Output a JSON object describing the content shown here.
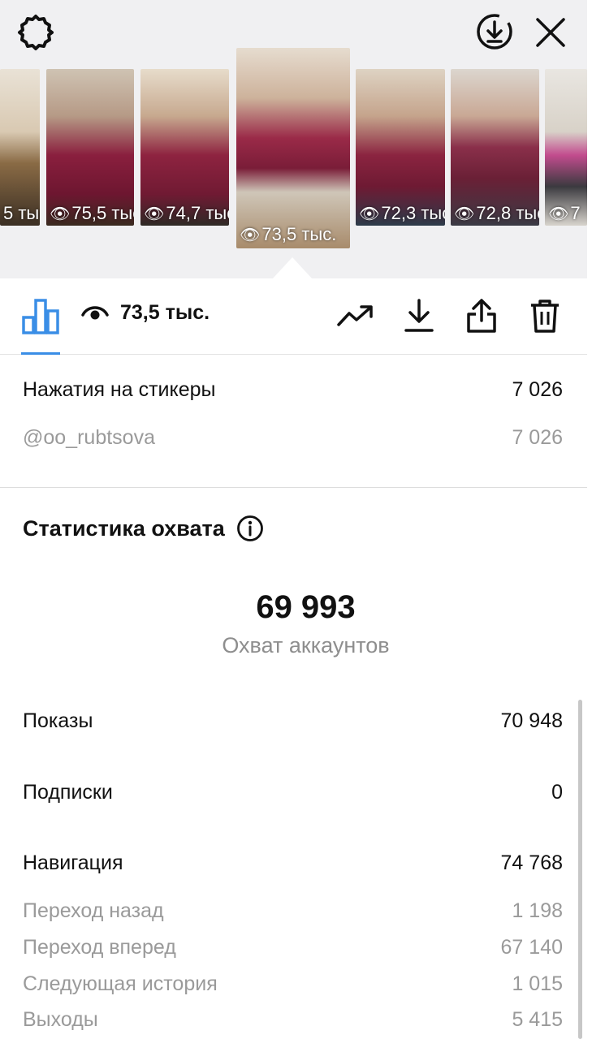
{
  "header": {
    "settings_icon": "gear-icon",
    "download_icon": "download-circle-icon",
    "close_icon": "close-icon"
  },
  "stories": [
    {
      "label": "5 тыс",
      "selected": false
    },
    {
      "label": "75,5 тыс",
      "selected": false
    },
    {
      "label": "74,7 тыс",
      "selected": false
    },
    {
      "label": "73,5 тыс.",
      "selected": true
    },
    {
      "label": "72,3 тыс",
      "selected": false
    },
    {
      "label": "72,8 тыс",
      "selected": false
    },
    {
      "label": "7",
      "selected": false
    }
  ],
  "toolbar": {
    "views_value": "73,5 тыс.",
    "stats_icon": "bar-chart-icon",
    "eye_icon": "eye-icon",
    "trend_icon": "trending-up-icon",
    "download_icon": "download-icon",
    "share_icon": "share-icon",
    "delete_icon": "trash-icon",
    "accent_color": "#3a8ee6"
  },
  "stickers": {
    "label": "Нажатия на стикеры",
    "value": "7 026",
    "items": [
      {
        "label": "@oo_rubtsova",
        "value": "7 026"
      }
    ]
  },
  "reach": {
    "title": "Статистика охвата",
    "info_icon": "info-icon",
    "accounts_reached": "69 993",
    "accounts_reached_label": "Охват аккаунтов",
    "impressions_label": "Показы",
    "impressions_value": "70 948",
    "follows_label": "Подписки",
    "follows_value": "0",
    "navigation_label": "Навигация",
    "navigation_value": "74 768",
    "navigation_items": [
      {
        "label": "Переход назад",
        "value": "1 198"
      },
      {
        "label": "Переход вперед",
        "value": "67 140"
      },
      {
        "label": "Следующая история",
        "value": "1 015"
      },
      {
        "label": "Выходы",
        "value": "5 415"
      }
    ]
  }
}
